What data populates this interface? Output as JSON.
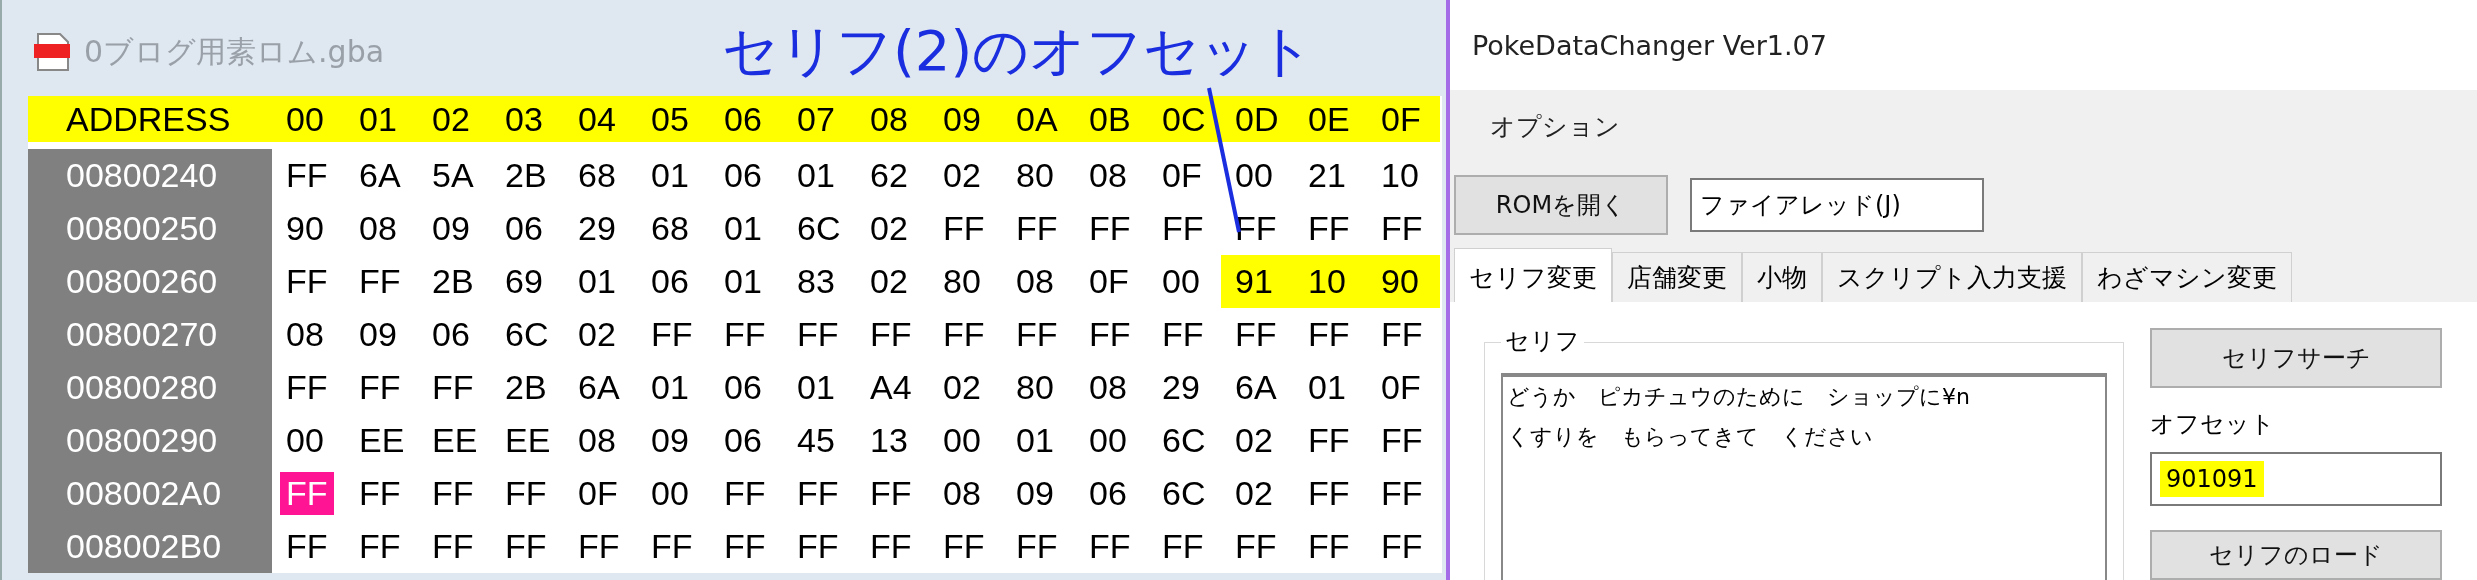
{
  "hex_editor": {
    "file_title": "0ブログ用素ロム.gba",
    "header": {
      "address_label": "ADDRESS",
      "columns": [
        "00",
        "01",
        "02",
        "03",
        "04",
        "05",
        "06",
        "07",
        "08",
        "09",
        "0A",
        "0B",
        "0C",
        "0D",
        "0E",
        "0F"
      ]
    },
    "rows": [
      {
        "address": "00800240",
        "bytes": [
          {
            "value": "FF",
            "marked": false,
            "selected": false
          },
          {
            "value": "6A",
            "marked": false,
            "selected": false
          },
          {
            "value": "5A",
            "marked": false,
            "selected": false
          },
          {
            "value": "2B",
            "marked": false,
            "selected": false
          },
          {
            "value": "68",
            "marked": false,
            "selected": false
          },
          {
            "value": "01",
            "marked": false,
            "selected": false
          },
          {
            "value": "06",
            "marked": false,
            "selected": false
          },
          {
            "value": "01",
            "marked": false,
            "selected": false
          },
          {
            "value": "62",
            "marked": false,
            "selected": false
          },
          {
            "value": "02",
            "marked": false,
            "selected": false
          },
          {
            "value": "80",
            "marked": false,
            "selected": false
          },
          {
            "value": "08",
            "marked": false,
            "selected": false
          },
          {
            "value": "0F",
            "marked": false,
            "selected": false
          },
          {
            "value": "00",
            "marked": false,
            "selected": false
          },
          {
            "value": "21",
            "marked": false,
            "selected": false
          },
          {
            "value": "10",
            "marked": false,
            "selected": false
          }
        ]
      },
      {
        "address": "00800250",
        "bytes": [
          {
            "value": "90",
            "marked": false,
            "selected": false
          },
          {
            "value": "08",
            "marked": false,
            "selected": false
          },
          {
            "value": "09",
            "marked": false,
            "selected": false
          },
          {
            "value": "06",
            "marked": false,
            "selected": false
          },
          {
            "value": "29",
            "marked": false,
            "selected": false
          },
          {
            "value": "68",
            "marked": false,
            "selected": false
          },
          {
            "value": "01",
            "marked": false,
            "selected": false
          },
          {
            "value": "6C",
            "marked": false,
            "selected": false
          },
          {
            "value": "02",
            "marked": false,
            "selected": false
          },
          {
            "value": "FF",
            "marked": false,
            "selected": false
          },
          {
            "value": "FF",
            "marked": false,
            "selected": false
          },
          {
            "value": "FF",
            "marked": false,
            "selected": false
          },
          {
            "value": "FF",
            "marked": false,
            "selected": false
          },
          {
            "value": "FF",
            "marked": false,
            "selected": false
          },
          {
            "value": "FF",
            "marked": false,
            "selected": false
          },
          {
            "value": "FF",
            "marked": false,
            "selected": false
          }
        ]
      },
      {
        "address": "00800260",
        "bytes": [
          {
            "value": "FF",
            "marked": false,
            "selected": false
          },
          {
            "value": "FF",
            "marked": false,
            "selected": false
          },
          {
            "value": "2B",
            "marked": false,
            "selected": false
          },
          {
            "value": "69",
            "marked": false,
            "selected": false
          },
          {
            "value": "01",
            "marked": false,
            "selected": false
          },
          {
            "value": "06",
            "marked": false,
            "selected": false
          },
          {
            "value": "01",
            "marked": false,
            "selected": false
          },
          {
            "value": "83",
            "marked": false,
            "selected": false
          },
          {
            "value": "02",
            "marked": false,
            "selected": false
          },
          {
            "value": "80",
            "marked": false,
            "selected": false
          },
          {
            "value": "08",
            "marked": false,
            "selected": false
          },
          {
            "value": "0F",
            "marked": false,
            "selected": false
          },
          {
            "value": "00",
            "marked": false,
            "selected": false
          },
          {
            "value": "91",
            "marked": true,
            "selected": false
          },
          {
            "value": "10",
            "marked": true,
            "selected": false
          },
          {
            "value": "90",
            "marked": true,
            "selected": false
          }
        ]
      },
      {
        "address": "00800270",
        "bytes": [
          {
            "value": "08",
            "marked": false,
            "selected": false
          },
          {
            "value": "09",
            "marked": false,
            "selected": false
          },
          {
            "value": "06",
            "marked": false,
            "selected": false
          },
          {
            "value": "6C",
            "marked": false,
            "selected": false
          },
          {
            "value": "02",
            "marked": false,
            "selected": false
          },
          {
            "value": "FF",
            "marked": false,
            "selected": false
          },
          {
            "value": "FF",
            "marked": false,
            "selected": false
          },
          {
            "value": "FF",
            "marked": false,
            "selected": false
          },
          {
            "value": "FF",
            "marked": false,
            "selected": false
          },
          {
            "value": "FF",
            "marked": false,
            "selected": false
          },
          {
            "value": "FF",
            "marked": false,
            "selected": false
          },
          {
            "value": "FF",
            "marked": false,
            "selected": false
          },
          {
            "value": "FF",
            "marked": false,
            "selected": false
          },
          {
            "value": "FF",
            "marked": false,
            "selected": false
          },
          {
            "value": "FF",
            "marked": false,
            "selected": false
          },
          {
            "value": "FF",
            "marked": false,
            "selected": false
          }
        ]
      },
      {
        "address": "00800280",
        "bytes": [
          {
            "value": "FF",
            "marked": false,
            "selected": false
          },
          {
            "value": "FF",
            "marked": false,
            "selected": false
          },
          {
            "value": "FF",
            "marked": false,
            "selected": false
          },
          {
            "value": "2B",
            "marked": false,
            "selected": false
          },
          {
            "value": "6A",
            "marked": false,
            "selected": false
          },
          {
            "value": "01",
            "marked": false,
            "selected": false
          },
          {
            "value": "06",
            "marked": false,
            "selected": false
          },
          {
            "value": "01",
            "marked": false,
            "selected": false
          },
          {
            "value": "A4",
            "marked": false,
            "selected": false
          },
          {
            "value": "02",
            "marked": false,
            "selected": false
          },
          {
            "value": "80",
            "marked": false,
            "selected": false
          },
          {
            "value": "08",
            "marked": false,
            "selected": false
          },
          {
            "value": "29",
            "marked": false,
            "selected": false
          },
          {
            "value": "6A",
            "marked": false,
            "selected": false
          },
          {
            "value": "01",
            "marked": false,
            "selected": false
          },
          {
            "value": "0F",
            "marked": false,
            "selected": false
          }
        ]
      },
      {
        "address": "00800290",
        "bytes": [
          {
            "value": "00",
            "marked": false,
            "selected": false
          },
          {
            "value": "EE",
            "marked": false,
            "selected": false
          },
          {
            "value": "EE",
            "marked": false,
            "selected": false
          },
          {
            "value": "EE",
            "marked": false,
            "selected": false
          },
          {
            "value": "08",
            "marked": false,
            "selected": false
          },
          {
            "value": "09",
            "marked": false,
            "selected": false
          },
          {
            "value": "06",
            "marked": false,
            "selected": false
          },
          {
            "value": "45",
            "marked": false,
            "selected": false
          },
          {
            "value": "13",
            "marked": false,
            "selected": false
          },
          {
            "value": "00",
            "marked": false,
            "selected": false
          },
          {
            "value": "01",
            "marked": false,
            "selected": false
          },
          {
            "value": "00",
            "marked": false,
            "selected": false
          },
          {
            "value": "6C",
            "marked": false,
            "selected": false
          },
          {
            "value": "02",
            "marked": false,
            "selected": false
          },
          {
            "value": "FF",
            "marked": false,
            "selected": false
          },
          {
            "value": "FF",
            "marked": false,
            "selected": false
          }
        ]
      },
      {
        "address": "008002A0",
        "bytes": [
          {
            "value": "FF",
            "marked": false,
            "selected": true
          },
          {
            "value": "FF",
            "marked": false,
            "selected": false
          },
          {
            "value": "FF",
            "marked": false,
            "selected": false
          },
          {
            "value": "FF",
            "marked": false,
            "selected": false
          },
          {
            "value": "0F",
            "marked": false,
            "selected": false
          },
          {
            "value": "00",
            "marked": false,
            "selected": false
          },
          {
            "value": "FF",
            "marked": false,
            "selected": false
          },
          {
            "value": "FF",
            "marked": false,
            "selected": false
          },
          {
            "value": "FF",
            "marked": false,
            "selected": false
          },
          {
            "value": "08",
            "marked": false,
            "selected": false
          },
          {
            "value": "09",
            "marked": false,
            "selected": false
          },
          {
            "value": "06",
            "marked": false,
            "selected": false
          },
          {
            "value": "6C",
            "marked": false,
            "selected": false
          },
          {
            "value": "02",
            "marked": false,
            "selected": false
          },
          {
            "value": "FF",
            "marked": false,
            "selected": false
          },
          {
            "value": "FF",
            "marked": false,
            "selected": false
          }
        ]
      },
      {
        "address": "008002B0",
        "bytes": [
          {
            "value": "FF",
            "marked": false,
            "selected": false
          },
          {
            "value": "FF",
            "marked": false,
            "selected": false
          },
          {
            "value": "FF",
            "marked": false,
            "selected": false
          },
          {
            "value": "FF",
            "marked": false,
            "selected": false
          },
          {
            "value": "FF",
            "marked": false,
            "selected": false
          },
          {
            "value": "FF",
            "marked": false,
            "selected": false
          },
          {
            "value": "FF",
            "marked": false,
            "selected": false
          },
          {
            "value": "FF",
            "marked": false,
            "selected": false
          },
          {
            "value": "FF",
            "marked": false,
            "selected": false
          },
          {
            "value": "FF",
            "marked": false,
            "selected": false
          },
          {
            "value": "FF",
            "marked": false,
            "selected": false
          },
          {
            "value": "FF",
            "marked": false,
            "selected": false
          },
          {
            "value": "FF",
            "marked": false,
            "selected": false
          },
          {
            "value": "FF",
            "marked": false,
            "selected": false
          },
          {
            "value": "FF",
            "marked": false,
            "selected": false
          },
          {
            "value": "FF",
            "marked": false,
            "selected": false
          }
        ]
      }
    ]
  },
  "annotation": {
    "text": "セリフ(2)のオフセット"
  },
  "window": {
    "title": "PokeDataChanger Ver1.07",
    "menu": [
      "オプション"
    ],
    "rom_button": "ROMを開く",
    "game_field": {
      "value": "ファイアレッド(J)"
    },
    "tabs": [
      {
        "label": "セリフ変更",
        "selected": true
      },
      {
        "label": "店舗変更",
        "selected": false
      },
      {
        "label": "小物",
        "selected": false
      },
      {
        "label": "スクリプト入力支援",
        "selected": false
      },
      {
        "label": "わざマシン変更",
        "selected": false
      }
    ],
    "dialogue_group": {
      "title": "セリフ",
      "lines": [
        "どうか　ピカチュウのために　ショップに¥n",
        "くすりを　もらってきて　ください"
      ]
    },
    "search_button": "セリフサーチ",
    "offset_label": "オフセット",
    "offset_field": {
      "value": "901091",
      "marked": true
    },
    "load_button": "セリフのロード"
  }
}
